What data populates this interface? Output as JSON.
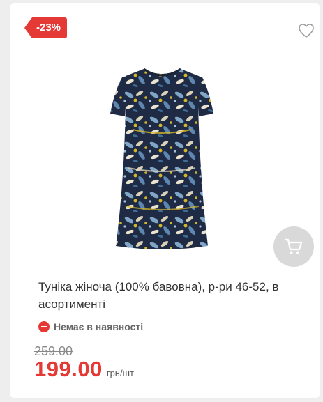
{
  "product": {
    "discount_badge": "-23%",
    "title": "Туніка жіноча (100% бавовна), р-ри 46-52, в асортименті",
    "stock_status": "Немає в наявності",
    "old_price": "259.00",
    "price": "199.00",
    "unit": "грн/шт"
  },
  "icons": {
    "wishlist": "heart-outline-icon",
    "cart": "shopping-cart-icon",
    "stock": "minus-circle-icon"
  },
  "colors": {
    "accent": "#e53935",
    "cart_button_bg": "#d9d9d9",
    "page_bg": "#eeeeee",
    "card_bg": "#ffffff"
  }
}
